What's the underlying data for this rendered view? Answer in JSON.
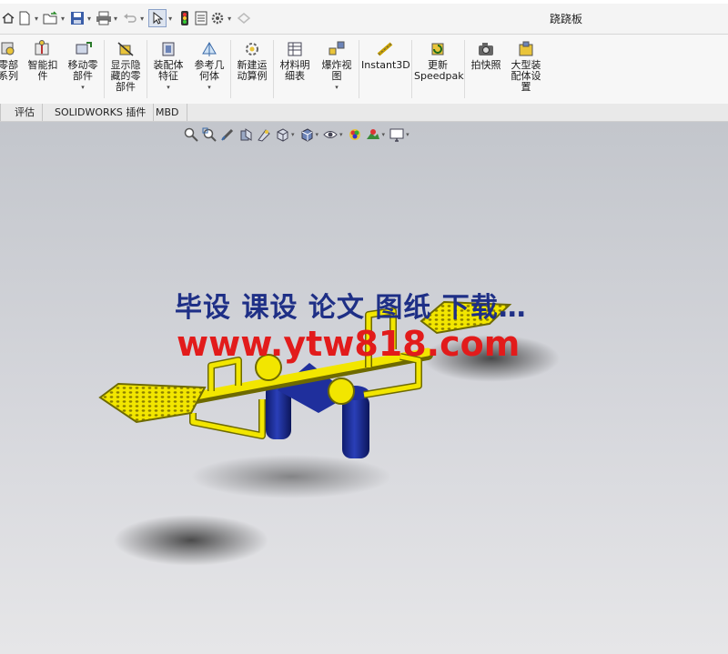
{
  "window": {
    "title": "跷跷板"
  },
  "quick_access": {
    "icons": [
      "home-icon",
      "new-document-icon",
      "open-icon",
      "save-icon",
      "print-icon",
      "undo-icon",
      "select-icon",
      "traffic-light-icon",
      "file-properties-icon",
      "options-gear-icon",
      "rebuild-icon"
    ]
  },
  "ribbon": {
    "buttons": [
      {
        "label": "零部\n系列",
        "icon": "part-series-icon",
        "has_dropdown": false
      },
      {
        "label": "智能扣\n件",
        "icon": "smart-fastener-icon",
        "has_dropdown": false
      },
      {
        "label": "移动零\n部件",
        "icon": "move-component-icon",
        "has_dropdown": true
      },
      {
        "label": "显示隐\n藏的零\n部件",
        "icon": "show-hidden-components-icon",
        "has_dropdown": false
      },
      {
        "label": "装配体\n特征",
        "icon": "assembly-feature-icon",
        "has_dropdown": true
      },
      {
        "label": "参考几\n何体",
        "icon": "reference-geometry-icon",
        "has_dropdown": true
      },
      {
        "label": "新建运\n动算例",
        "icon": "new-motion-study-icon",
        "has_dropdown": false
      },
      {
        "label": "材料明\n细表",
        "icon": "bill-of-materials-icon",
        "has_dropdown": false
      },
      {
        "label": "爆炸视\n图",
        "icon": "exploded-view-icon",
        "has_dropdown": true
      },
      {
        "label": "Instant3D",
        "icon": "instant3d-icon",
        "has_dropdown": false
      },
      {
        "label": "更新\nSpeedpak",
        "icon": "update-speedpak-icon",
        "has_dropdown": false
      },
      {
        "label": "拍快照",
        "icon": "snapshot-camera-icon",
        "has_dropdown": false
      },
      {
        "label": "大型装\n配体设\n置",
        "icon": "large-assembly-settings-icon",
        "has_dropdown": false
      }
    ]
  },
  "tabs": [
    {
      "label": "评估"
    },
    {
      "label": "SOLIDWORKS 插件"
    },
    {
      "label": "MBD"
    }
  ],
  "view_toolbar": {
    "icons": [
      "zoom-to-fit-icon",
      "zoom-to-area-icon",
      "previous-view-icon",
      "section-view-icon",
      "dynamic-annotation-icon",
      "view-orientation-icon",
      "display-style-icon",
      "hide-show-items-icon",
      "edit-appearance-icon",
      "apply-scene-icon",
      "view-settings-icon"
    ]
  },
  "watermark": {
    "line1": "毕设 课设 论文 图纸 下载…",
    "line2": "www.ytw818.com"
  },
  "colors": {
    "model_yellow": "#f2e600",
    "model_blue": "#1f2f9c",
    "watermark_blue": "#1e2f86",
    "watermark_red": "#e21b1b"
  }
}
